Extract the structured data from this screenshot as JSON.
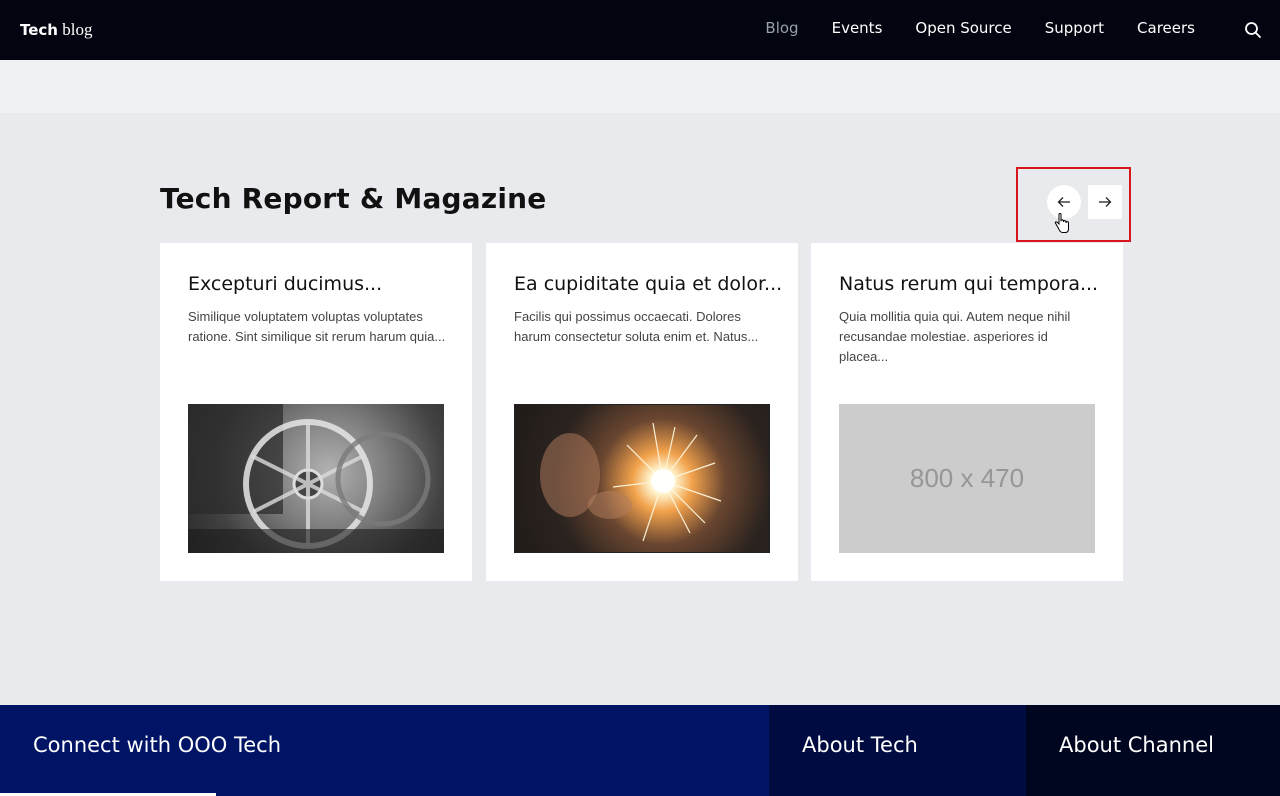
{
  "header": {
    "logo": {
      "strong": "Tech",
      "light": " blog"
    },
    "nav": [
      "Blog",
      "Events",
      "Open Source",
      "Support",
      "Careers"
    ],
    "active_nav": "Blog",
    "search_icon": "search-icon"
  },
  "section": {
    "title": "Tech Report & Magazine",
    "prev_icon": "arrow-left-icon",
    "next_icon": "arrow-right-icon",
    "highlight_color": "#d8151c"
  },
  "cards": [
    {
      "title": "Excepturi ducimus...",
      "desc": "Similique voluptatem voluptas voluptates ratione. Sint similique sit rerum harum quia...",
      "image": "wagon-wheel-photo"
    },
    {
      "title": "Ea cupiditate quia et dolor...",
      "desc": "Facilis qui possimus occaecati. Dolores harum consectetur soluta enim et. Natus...",
      "image": "sparkler-photo"
    },
    {
      "title": "Natus rerum qui tempora...",
      "desc": "Quia mollitia quia qui. Autem neque nihil recusandae molestiae. asperiores id placea...",
      "image_placeholder": "800 x 470"
    }
  ],
  "footer": {
    "col1": "Connect with OOO Tech",
    "col2": "About Tech",
    "col3": "About Channel",
    "colors": {
      "col1": "#001466",
      "col2": "#000c41",
      "col3": "#00061f"
    }
  }
}
